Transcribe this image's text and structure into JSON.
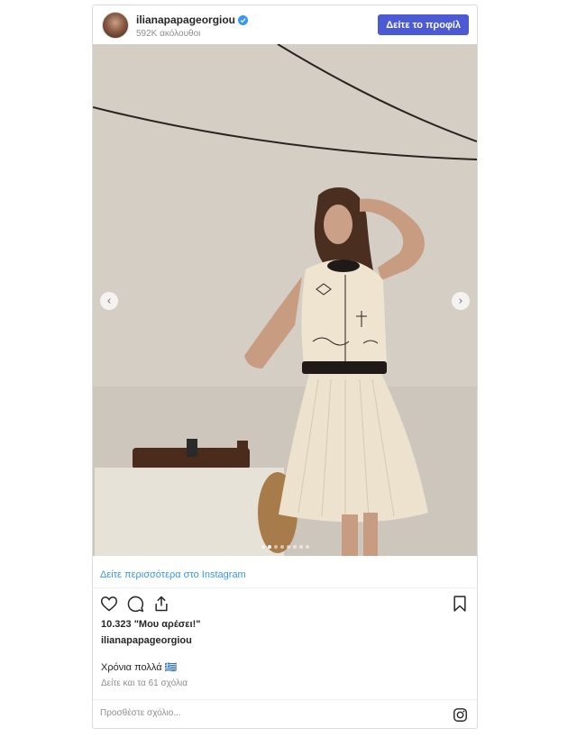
{
  "header": {
    "username": "ilianapapageorgiou",
    "followers": "592K ακόλουθοι",
    "profile_button": "Δείτε το προφίλ",
    "verified_icon": "verified-badge-icon"
  },
  "photo": {
    "description_icons": [
      "chevron-left-icon",
      "chevron-right-icon"
    ],
    "carousel": {
      "total": 8,
      "active": 1
    }
  },
  "see_more": "Δείτε περισσότερα στο Instagram",
  "actions": {
    "icons": [
      "heart-icon",
      "comment-icon",
      "share-icon",
      "bookmark-icon"
    ]
  },
  "likes": "10.323 \"Μου αρέσει!\"",
  "caption_user": "ilianapapageorgiou",
  "caption": "Χρόνια πολλά 🇬🇷",
  "comments_link": "Δείτε και τα 61 σχόλια",
  "comment_placeholder": "Προσθέστε σχόλιο...",
  "colors": {
    "accent": "#4c5bd4",
    "link": "#3897f0",
    "muted": "#8e8e8e"
  }
}
